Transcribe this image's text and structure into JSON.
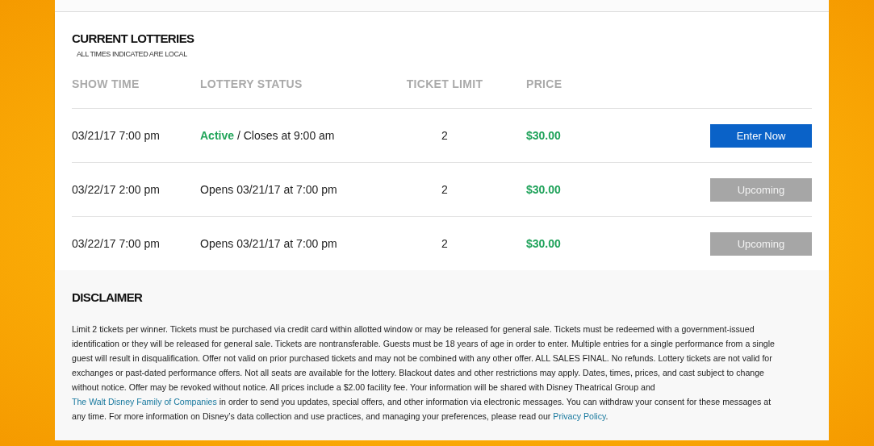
{
  "lotteries": {
    "title": "CURRENT LOTTERIES",
    "note": "ALL TIMES INDICATED ARE LOCAL",
    "columns": [
      "SHOW TIME",
      "LOTTERY STATUS",
      "TICKET LIMIT",
      "PRICE"
    ],
    "rows": [
      {
        "show_time": "03/21/17 7:00 pm",
        "status": "**Active** / Closes at 9:00 am",
        "limit": "2",
        "price": "$30.00",
        "button": {
          "label": "Enter Now",
          "disabled": false
        }
      },
      {
        "show_time": "03/22/17 2:00 pm",
        "status": "Opens 03/21/17 at 7:00 pm",
        "limit": "2",
        "price": "$30.00",
        "button": {
          "label": "Upcoming",
          "disabled": true
        }
      },
      {
        "show_time": "03/22/17 7:00 pm",
        "status": "Opens 03/21/17 at 7:00 pm",
        "limit": "2",
        "price": "$30.00",
        "button": {
          "label": "Upcoming",
          "disabled": true
        }
      }
    ]
  },
  "disclaimer": {
    "title": "DISCLAIMER",
    "parts": [
      {
        "kind": "text",
        "text": "Limit 2 tickets per winner. Tickets must be purchased via credit card within allotted window or may be released for general sale. Tickets must be redeemed with a government-issued identification or they will be released for general sale. Tickets are nontransferable. Guests must be 18 years of age in order to enter. Multiple entries for a single performance from a single guest will result in disqualification. Offer not valid on prior purchased tickets and may not be combined with any other offer. ALL SALES FINAL. No refunds. Lottery tickets are not valid for exchanges or past-dated performance offers. Not all seats are available for the lottery. Blackout dates and other restrictions may apply. Dates, times, prices, and cast subject to change without notice. Offer may be revoked without notice. All prices include a $2.00 facility fee. Your information will be shared with Disney Theatrical Group and "
      },
      {
        "kind": "link",
        "text": "The Walt Disney Family of Companies"
      },
      {
        "kind": "text",
        "text": " in order to send you updates, special offers, and other information via electronic messages. You can withdraw your consent for these messages at any time. For more information on Disney’s data collection and use practices, and managing your preferences, please read our "
      },
      {
        "kind": "link",
        "text": "Privacy Policy"
      },
      {
        "kind": "text",
        "text": "."
      }
    ]
  }
}
